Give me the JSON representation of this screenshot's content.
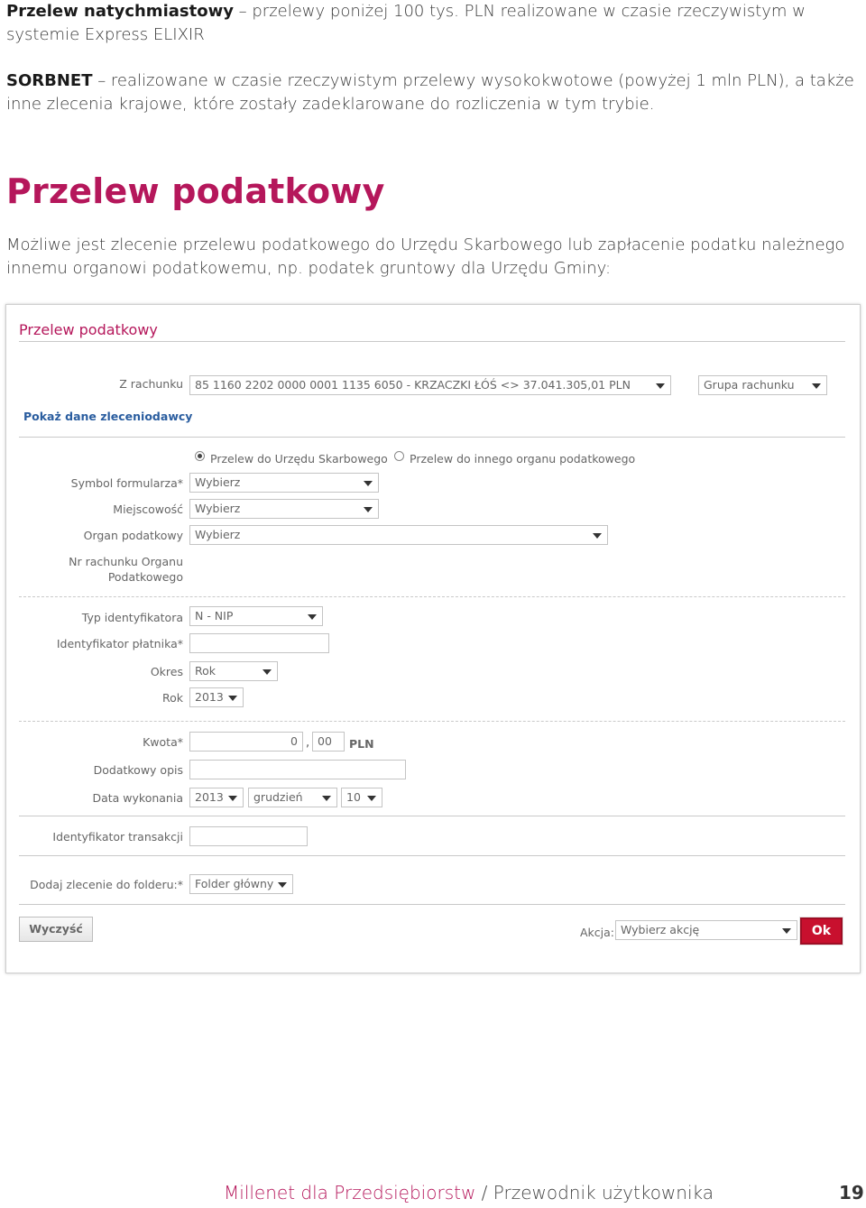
{
  "intro": {
    "p1_bold": "Przelew natychmiastowy",
    "p1_text": " – przelewy poniżej 100 tys. PLN realizowane w czasie rzeczywistym w systemie Express ELIXIR",
    "p2_bold": "SORBNET",
    "p2_text": " – realizowane w czasie rzeczywistym przelewy wysokokwotowe (powyżej 1 mln PLN), a także inne zlecenia krajowe, które zostały zadeklarowane do rozliczenia w tym trybie."
  },
  "section": {
    "heading": "Przelew podatkowy",
    "description": "Możliwe jest zlecenie przelewu podatkowego do Urzędu Skarbowego lub zapłacenie podatku należnego innemu organowi podatkowemu, np. podatek gruntowy dla Urzędu Gminy:"
  },
  "form": {
    "title": "Przelew podatkowy",
    "account_label": "Z rachunku",
    "account_value": "85 1160 2202 0000 0001 1135 6050 - KRZACZKI ŁÓŚ <>    37.041.305,01 PLN",
    "account_group": "Grupa rachunku",
    "show_orderer_link": "Pokaż dane zleceniodawcy",
    "radio_tax_office": "Przelew do Urzędu Skarbowego",
    "radio_other": "Przelew do innego organu podatkowego",
    "form_symbol_label": "Symbol formularza*",
    "form_symbol_value": "Wybierz",
    "city_label": "Miejscowość",
    "city_value": "Wybierz",
    "tax_office_label": "Organ podatkowy",
    "tax_office_value": "Wybierz",
    "account_no_label_1": "Nr rachunku Organu",
    "account_no_label_2": "Podatkowego",
    "id_type_label": "Typ identyfikatora",
    "id_type_value": "N - NIP",
    "payer_id_label": "Identyfikator płatnika*",
    "payer_id_value": "",
    "period_label": "Okres",
    "period_value": "Rok",
    "year_label": "Rok",
    "year_value": "2013",
    "amount_label": "Kwota*",
    "amount_int": "0",
    "amount_sep": ",",
    "amount_dec": "00",
    "currency": "PLN",
    "extra_desc_label": "Dodatkowy opis",
    "extra_desc_value": "",
    "exec_date_label": "Data wykonania",
    "exec_year": "2013",
    "exec_month": "grudzień",
    "exec_day": "10",
    "transaction_id_label": "Identyfikator transakcji",
    "transaction_id_value": "",
    "folder_label": "Dodaj zlecenie do folderu:*",
    "folder_value": "Folder główny",
    "clear_button": "Wyczyść",
    "action_label": "Akcja:",
    "action_value": "Wybierz akcję",
    "ok_button": "Ok"
  },
  "footer": {
    "brand": "Millenet dla Przedsiębiorstw",
    "separator": " / ",
    "guide": "Przewodnik użytkownika",
    "page_number": "19"
  },
  "colors": {
    "accent": "#b5175b",
    "link": "#2a5d9f",
    "ok_button": "#c8102e"
  }
}
